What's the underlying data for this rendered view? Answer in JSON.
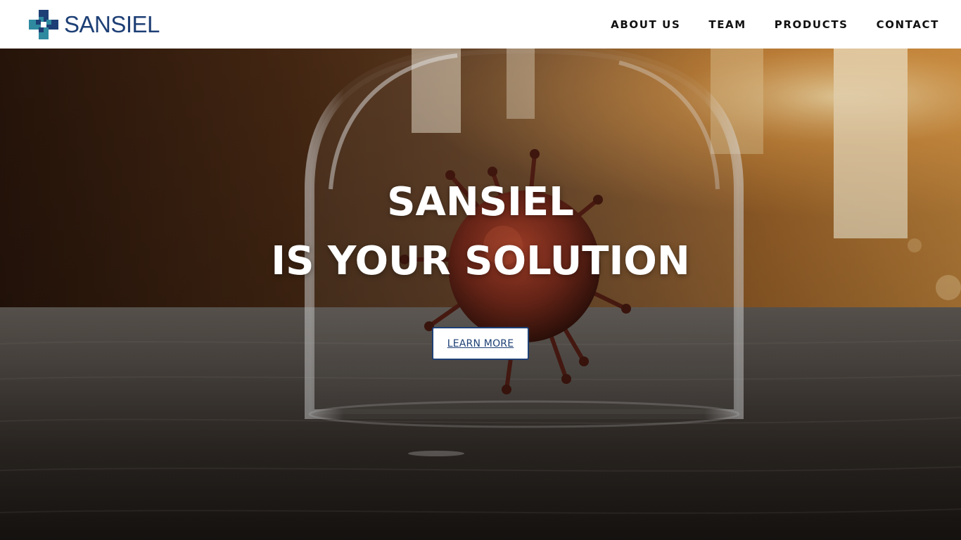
{
  "brand": {
    "name": "SANSIEL",
    "color": "#1d3f75",
    "accent": "#2f8aa0",
    "logo_icon": "cross-pixel-icon"
  },
  "nav": {
    "items": [
      {
        "label": "ABOUT US"
      },
      {
        "label": "TEAM"
      },
      {
        "label": "PRODUCTS"
      },
      {
        "label": "CONTACT"
      }
    ]
  },
  "hero": {
    "title_line1": "SANSIEL",
    "title_line2": "IS YOUR SOLUTION",
    "cta_label": "LEARN MORE",
    "background_image": "virus-under-glass-dome-photo"
  }
}
